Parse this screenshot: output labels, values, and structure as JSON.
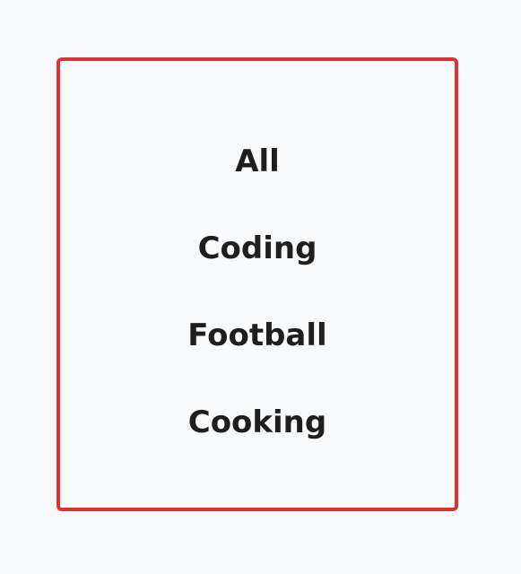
{
  "menu": {
    "border_color": "#e03131",
    "items": [
      {
        "label": "All"
      },
      {
        "label": "Coding"
      },
      {
        "label": "Football"
      },
      {
        "label": "Cooking"
      }
    ]
  }
}
